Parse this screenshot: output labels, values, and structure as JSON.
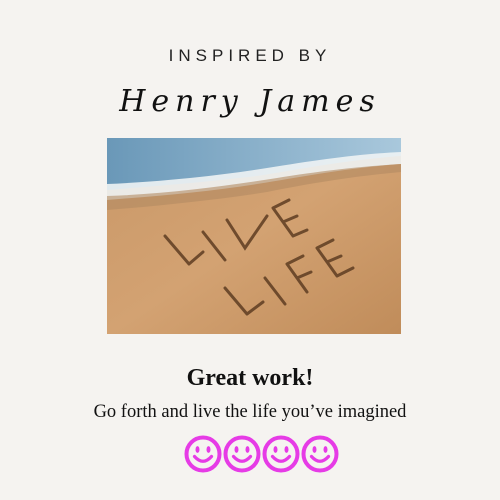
{
  "header": {
    "eyebrow": "INSPIRED BY",
    "author": "Henry James"
  },
  "image": {
    "sand_writing": [
      "LIVE",
      "LIFE"
    ],
    "alt": "LIVE LIFE written in beach sand"
  },
  "message": {
    "headline": "Great work!",
    "subline": "Go forth and live the life you’ve imagined"
  },
  "decor": {
    "smiley_count": 4,
    "smiley_color": "#e63be6",
    "icon": "smiley-face-icon"
  }
}
